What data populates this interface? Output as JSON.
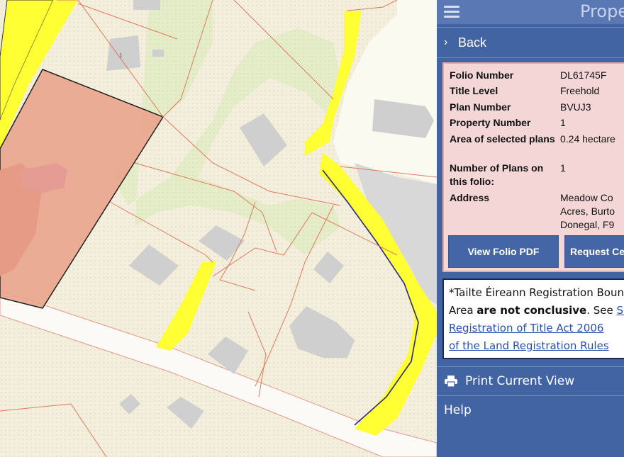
{
  "panel": {
    "title": "Prope",
    "back_label": "Back",
    "details": [
      {
        "label": "Folio Number",
        "value": "DL61745F"
      },
      {
        "label": "Title Level",
        "value": "Freehold"
      },
      {
        "label": "Plan Number",
        "value": "BVUJ3"
      },
      {
        "label": "Property Number",
        "value": "1"
      },
      {
        "label": "Area of selected plans",
        "value": "0.24 hectare"
      },
      {
        "label": "Number of Plans on this folio:",
        "value": "1"
      },
      {
        "label": "Address",
        "value_lines": [
          "Meadow Co",
          "Acres, Burto",
          "Donegal, F9"
        ]
      }
    ],
    "buttons": {
      "view_folio": "View Folio PDF",
      "request_cert": "Request Ce"
    },
    "notice": {
      "line1": "*Tailte Éireann Registration Bounc",
      "line2_prefix": "Area ",
      "line2_bold": "are not conclusive",
      "line2_suffix": ". See ",
      "link1": "Sec",
      "link2": "Registration of Title Act 2006",
      "link3": "of the Land Registration Rules"
    },
    "menu": {
      "print_label": "Print Current View",
      "help_label": "Help"
    }
  },
  "map": {
    "parcel_label": "1"
  },
  "colors": {
    "panel_bg": "#4364a3",
    "info_bg": "#f4d6d6",
    "road": "#ffff33",
    "selected_parcel": "#e9a48c"
  }
}
